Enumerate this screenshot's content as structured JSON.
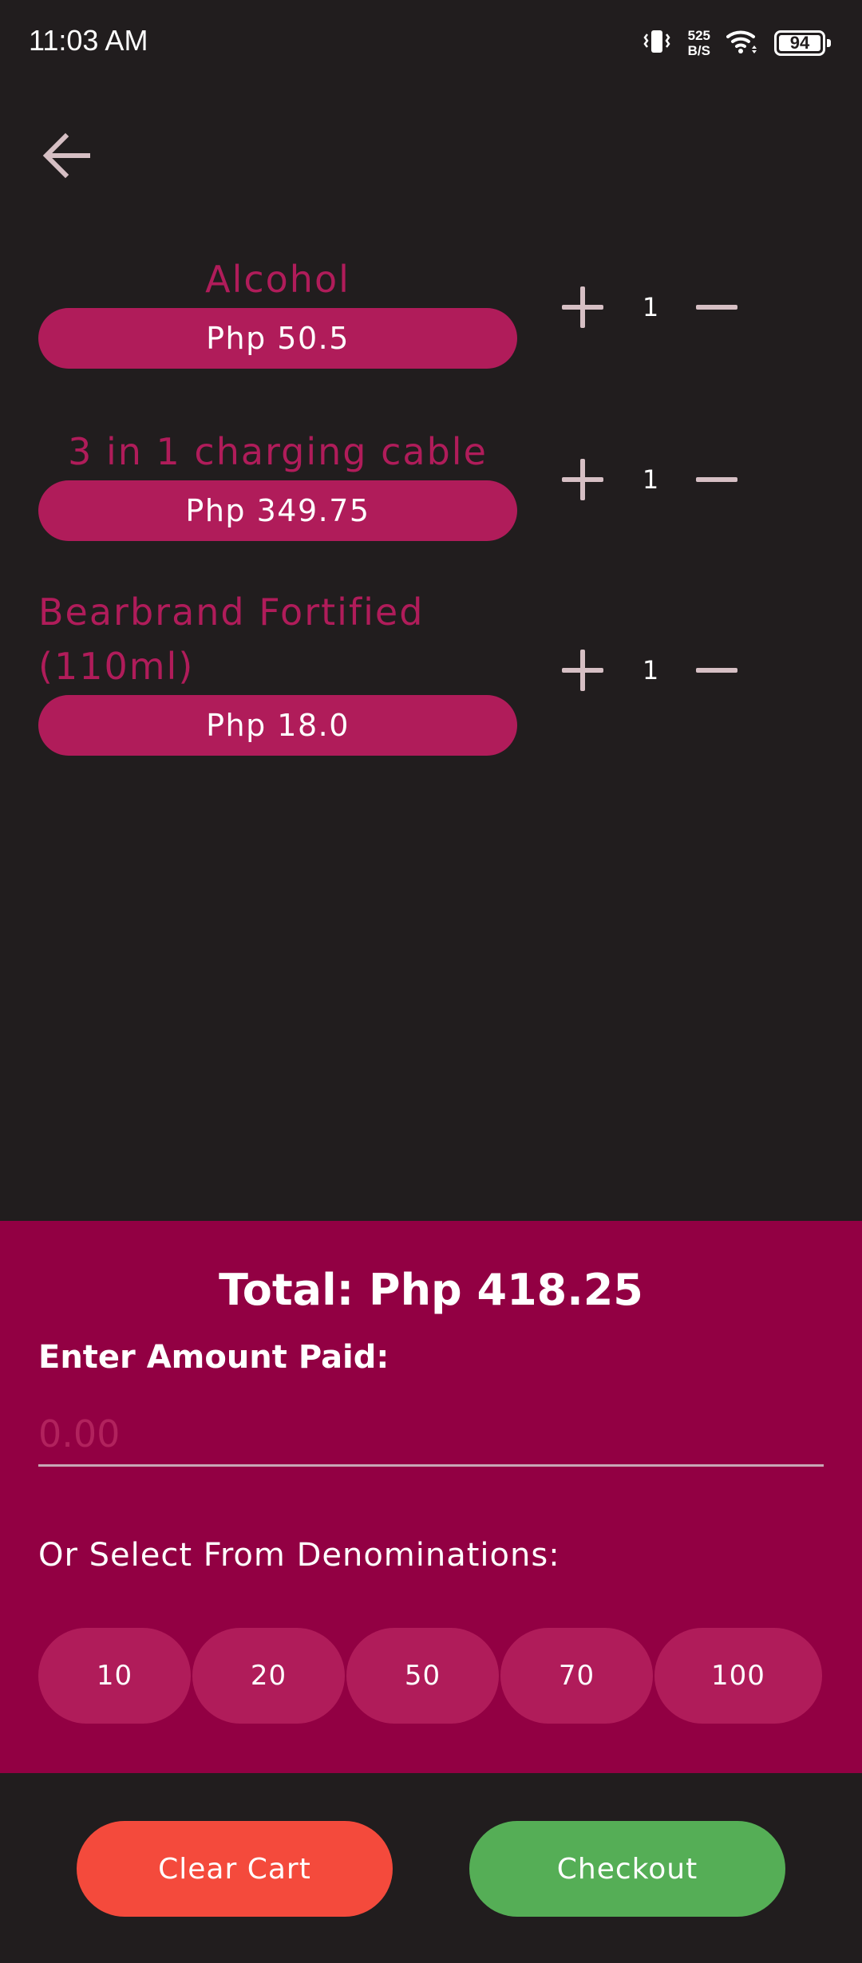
{
  "status_bar": {
    "time": "11:03 AM",
    "net_speed_value": "525",
    "net_speed_unit": "B/S",
    "battery_level": "94",
    "icons": [
      "vibrate-icon",
      "wifi-icon",
      "battery-icon"
    ]
  },
  "nav": {
    "back_icon": "arrow-left-icon"
  },
  "cart": {
    "items": [
      {
        "name": "Alcohol",
        "price": "Php 50.5",
        "quantity": "1"
      },
      {
        "name": "3 in 1 charging cable",
        "price": "Php 349.75",
        "quantity": "1"
      },
      {
        "name": "Bearbrand Fortified (110ml)",
        "price": "Php 18.0",
        "quantity": "1"
      }
    ]
  },
  "payment": {
    "total": "Total: Php 418.25",
    "amount_label": "Enter Amount Paid:",
    "amount_placeholder": "0.00",
    "amount_value": "",
    "denominations_label": "Or Select From Denominations:",
    "denominations": [
      "10",
      "20",
      "50",
      "70",
      "100"
    ]
  },
  "actions": {
    "clear_label": "Clear Cart",
    "checkout_label": "Checkout"
  },
  "colors": {
    "background": "#211d1e",
    "accent": "#b01c5a",
    "panel": "#920043",
    "clear": "#f44a3c",
    "checkout": "#55ae56",
    "control": "#d6bfc4"
  }
}
